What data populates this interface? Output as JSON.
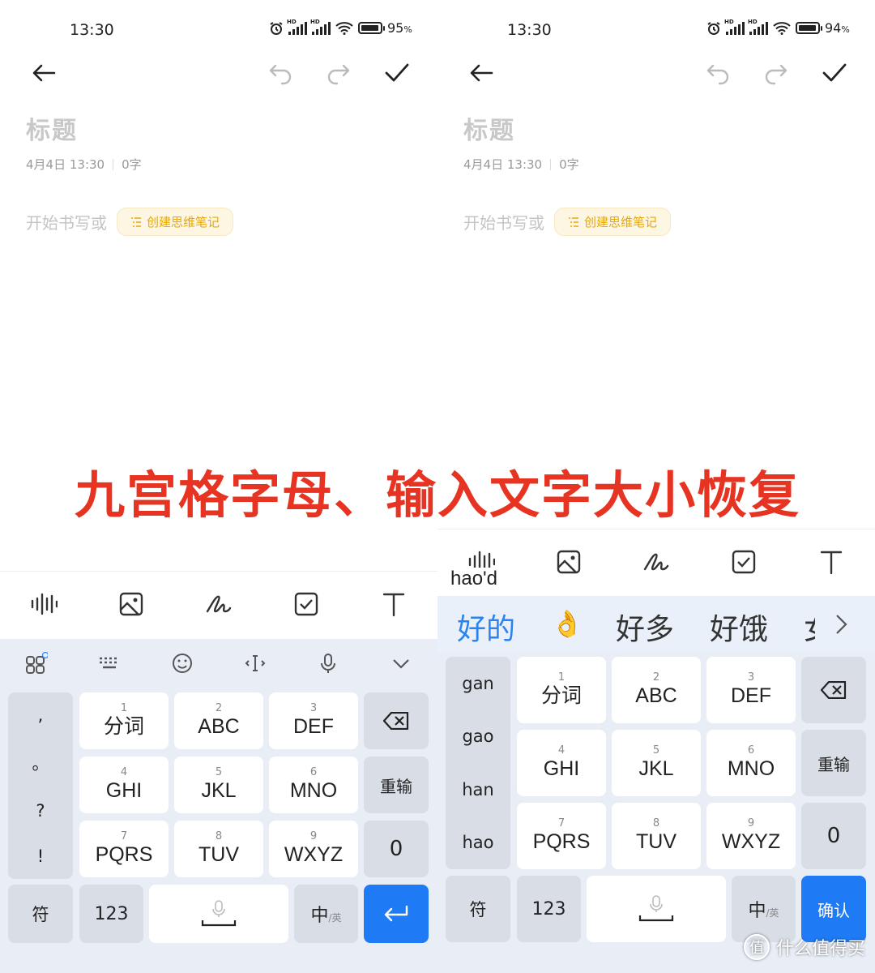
{
  "left": {
    "status": {
      "time": "13:30",
      "battery_pct": "95",
      "battery_unit": "%",
      "battery_level": 0.95
    },
    "title_placeholder": "标题",
    "meta_date": "4月4日 13:30",
    "meta_count": "0字",
    "body_placeholder": "开始书写或",
    "mindmap_button": "创建思维笔记",
    "keys": {
      "r1": [
        {
          "num": "1",
          "lbl": "分词"
        },
        {
          "num": "2",
          "lbl": "ABC"
        },
        {
          "num": "3",
          "lbl": "DEF"
        }
      ],
      "r2": [
        {
          "num": "4",
          "lbl": "GHI"
        },
        {
          "num": "5",
          "lbl": "JKL"
        },
        {
          "num": "6",
          "lbl": "MNO"
        }
      ],
      "r3": [
        {
          "num": "7",
          "lbl": "PQRS"
        },
        {
          "num": "8",
          "lbl": "TUV"
        },
        {
          "num": "9",
          "lbl": "WXYZ"
        }
      ],
      "reinput": "重输",
      "zero": "0",
      "symbols": "符",
      "num123": "123",
      "lang_main": "中",
      "lang_sub": "/英",
      "punct": [
        ",",
        "。",
        "?",
        "!"
      ]
    }
  },
  "right": {
    "status": {
      "time": "13:30",
      "battery_pct": "94",
      "battery_unit": "%",
      "battery_level": 0.94
    },
    "title_placeholder": "标题",
    "meta_date": "4月4日 13:30",
    "meta_count": "0字",
    "body_placeholder": "开始书写或",
    "mindmap_button": "创建思维笔记",
    "composition": "hao'd",
    "candidates": [
      "好的",
      "👌",
      "好多",
      "好饿",
      "女"
    ],
    "pinyin_options": [
      "gan",
      "gao",
      "han",
      "hao"
    ],
    "keys": {
      "r1": [
        {
          "num": "1",
          "lbl": "分词"
        },
        {
          "num": "2",
          "lbl": "ABC"
        },
        {
          "num": "3",
          "lbl": "DEF"
        }
      ],
      "r2": [
        {
          "num": "4",
          "lbl": "GHI"
        },
        {
          "num": "5",
          "lbl": "JKL"
        },
        {
          "num": "6",
          "lbl": "MNO"
        }
      ],
      "r3": [
        {
          "num": "7",
          "lbl": "PQRS"
        },
        {
          "num": "8",
          "lbl": "TUV"
        },
        {
          "num": "9",
          "lbl": "WXYZ"
        }
      ],
      "reinput": "重输",
      "zero": "0",
      "symbols": "符",
      "num123": "123",
      "lang_main": "中",
      "lang_sub": "/英",
      "confirm": "确认"
    }
  },
  "overlay_caption": "九宫格字母、输入文字大小恢复",
  "watermark": {
    "logo": "值",
    "text": "什么值得买"
  },
  "colors": {
    "accent_blue": "#1f7bf5",
    "caption_red": "#e63322",
    "mind_yellow": "#e8a70a"
  }
}
